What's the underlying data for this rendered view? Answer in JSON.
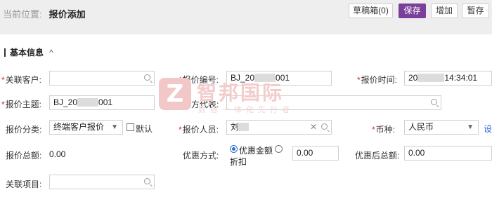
{
  "breadcrumb": {
    "prefix": "当前位置:",
    "current": "报价添加"
  },
  "toolbar": {
    "draft": "草稿箱(0)",
    "save": "保存",
    "add": "增加",
    "hold": "暂存"
  },
  "section": {
    "title": "基本信息",
    "toggle": "^"
  },
  "form": {
    "customer": {
      "label": "关联客户:",
      "value": ""
    },
    "quote_no": {
      "label": "报价编号:",
      "value_prefix": "BJ_20",
      "value_suffix": "001"
    },
    "quote_time": {
      "label": "报价时间:",
      "value_prefix": "20",
      "value_suffix": "14:34:01"
    },
    "subject": {
      "label": "报价主题:",
      "value_prefix": "BJ_20",
      "value_suffix": "001"
    },
    "counterpart": {
      "label": "对方代表:",
      "value": ""
    },
    "category": {
      "label": "报价分类:",
      "value": "终端客户报价",
      "default_label": "默认",
      "default_checked": false
    },
    "staff": {
      "label": "报价人员:",
      "value": "刘"
    },
    "currency": {
      "label": "币种:",
      "value": "人民币",
      "link": "设"
    },
    "total": {
      "label": "报价总额:",
      "value": "0.00"
    },
    "discount_method": {
      "label": "优惠方式:",
      "option1": "优惠金额",
      "option2": "折扣",
      "selected": "优惠金额",
      "amount": "0.00"
    },
    "after_total": {
      "label": "优惠后总额:",
      "value": "0.00"
    },
    "project": {
      "label": "关联项目:",
      "value": ""
    }
  },
  "watermark": {
    "logo": "Z",
    "name": "智邦国际",
    "slogan": "数智一体化先行者"
  }
}
